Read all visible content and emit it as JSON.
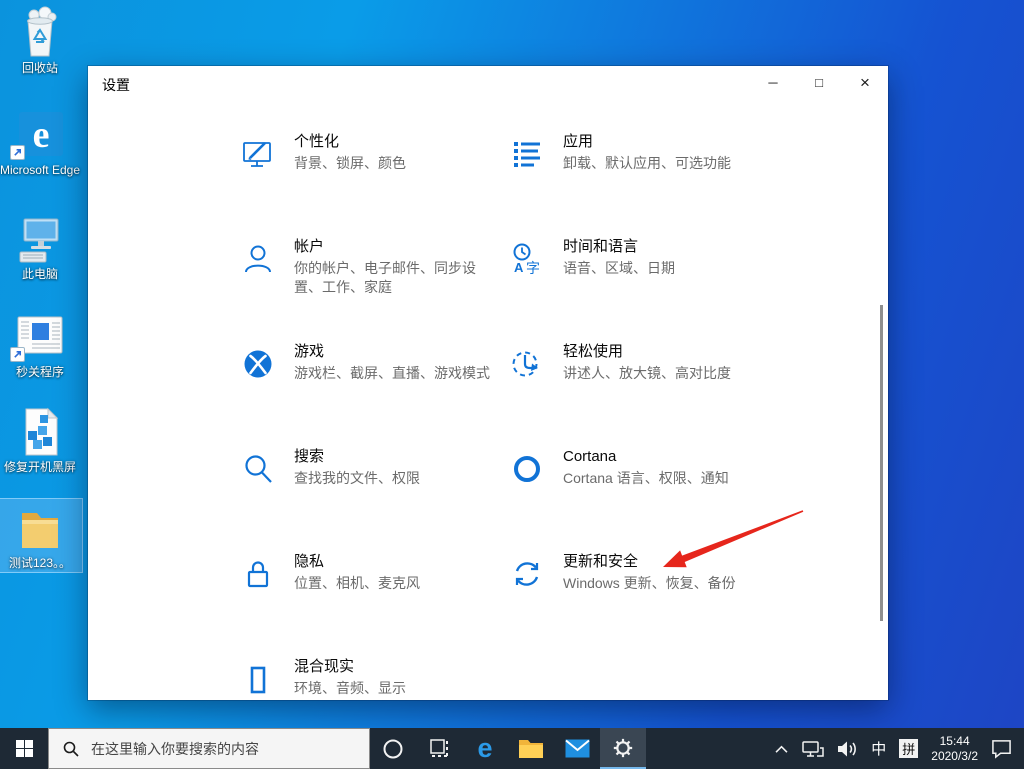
{
  "desktop": {
    "icons": [
      {
        "label": "回收站",
        "icon": "recycle-bin-icon"
      },
      {
        "label": "Microsoft Edge",
        "icon": "edge-icon"
      },
      {
        "label": "此电脑",
        "icon": "this-pc-icon"
      },
      {
        "label": "秒关程序",
        "icon": "app-window-shortcut-icon"
      },
      {
        "label": "修复开机黑屏",
        "icon": "registry-file-icon"
      },
      {
        "label": "测试123。。",
        "icon": "folder-icon",
        "selected": true
      }
    ]
  },
  "window": {
    "title": "设置",
    "accent_color": "#1173d6",
    "controls": {
      "minimize": "─",
      "maximize": "□",
      "close": "×"
    },
    "categories": [
      {
        "title": "个性化",
        "subtitle": "背景、锁屏、颜色",
        "icon": "personalization-icon"
      },
      {
        "title": "应用",
        "subtitle": "卸载、默认应用、可选功能",
        "icon": "apps-icon"
      },
      {
        "title": "帐户",
        "subtitle": "你的帐户、电子邮件、同步设置、工作、家庭",
        "icon": "accounts-icon"
      },
      {
        "title": "时间和语言",
        "subtitle": "语音、区域、日期",
        "icon": "time-language-icon"
      },
      {
        "title": "游戏",
        "subtitle": "游戏栏、截屏、直播、游戏模式",
        "icon": "gaming-icon"
      },
      {
        "title": "轻松使用",
        "subtitle": "讲述人、放大镜、高对比度",
        "icon": "ease-of-access-icon"
      },
      {
        "title": "搜索",
        "subtitle": "查找我的文件、权限",
        "icon": "search-icon"
      },
      {
        "title": "Cortana",
        "subtitle": "Cortana 语言、权限、通知",
        "icon": "cortana-icon"
      },
      {
        "title": "隐私",
        "subtitle": "位置、相机、麦克风",
        "icon": "privacy-icon"
      },
      {
        "title": "更新和安全",
        "subtitle": "Windows 更新、恢复、备份",
        "icon": "update-security-icon",
        "annotated": true
      },
      {
        "title": "混合现实",
        "subtitle": "环境、音频、显示",
        "icon": "mixed-reality-icon"
      }
    ]
  },
  "annotation": {
    "type": "red-arrow",
    "points_to": "更新和安全",
    "color": "#e6261c"
  },
  "taskbar": {
    "search_placeholder": "在这里输入你要搜索的内容",
    "tray": {
      "ime_lang": "中",
      "ime_mode": "拼",
      "time": "15:44",
      "date": "2020/3/2"
    }
  }
}
